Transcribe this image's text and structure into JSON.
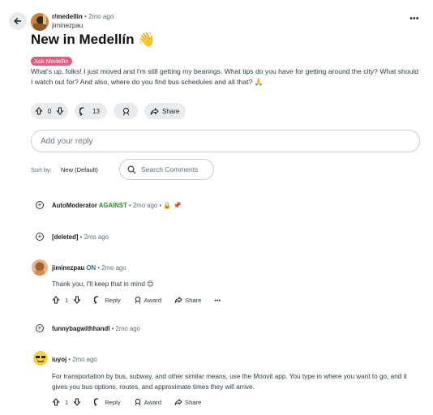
{
  "post": {
    "subreddit": "r/medellin",
    "time": "• 2mo ago",
    "author": "jiminezpau",
    "title": "New in Medellín 👋",
    "flair": "Ask Medellin",
    "body": "What's up, folks! I just moved and I'm still getting my bearings. What tips do you have for getting around the city? What should I watch out for? And also, where do you find bus schedules and all that? 🙏",
    "votes": "0",
    "comments": "13",
    "share_label": "Share"
  },
  "reply": {
    "placeholder": "Add your reply"
  },
  "sort": {
    "label": "Sort by:",
    "value": "New (Default)",
    "search_placeholder": "Search Comments"
  },
  "comments": [
    {
      "author": "AutoModerator",
      "tag": "AGAINST",
      "time": "• 2mo ago •",
      "collapsed": true
    },
    {
      "author": "[deleted]",
      "time": "• 2mo ago",
      "collapsed": true
    },
    {
      "author": "jiminezpau",
      "tag": "ON",
      "time": "• 2mo ago",
      "text": "Thank you, I'll keep that in mind 😊",
      "votes": "1",
      "reply": "Reply",
      "award": "Award",
      "share": "Share"
    },
    {
      "author": "funnybagwithhandl",
      "time": "• 2mo ago",
      "collapsed": true
    },
    {
      "author": "iuyoj",
      "time": "• 2mo ago",
      "text": "For transportation by bus, subway, and other similar means, use the Moovit app. You type in where you want to go, and it gives you bus options, routes, and approximate times they will arrive.",
      "votes": "1",
      "reply": "Reply",
      "award": "Award",
      "share": "Share"
    }
  ],
  "colors": {
    "flair": "#e25c7f",
    "pill": "#e9ecef",
    "against": "#2e8b2e",
    "on": "#1a6fd0"
  }
}
